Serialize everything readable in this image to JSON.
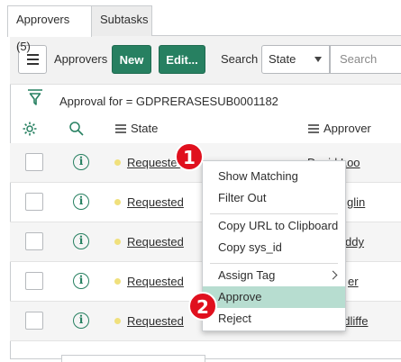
{
  "tabs": [
    {
      "label": "Approvers (5)",
      "active": true
    },
    {
      "label": "Subtasks",
      "active": false
    }
  ],
  "toolbar": {
    "title": "Approvers",
    "new_label": "New",
    "edit_label": "Edit...",
    "search_label": "Search",
    "search_field": "State",
    "search_placeholder": "Search"
  },
  "breadcrumb": {
    "text": "Approval for = GDPRERASESUB0001182"
  },
  "columns": {
    "state": "State",
    "approver": "Approver"
  },
  "rows": [
    {
      "state": "Requested",
      "approver": "David Loo"
    },
    {
      "state": "Requested",
      "approver": "glin"
    },
    {
      "state": "Requested",
      "approver": "ddy"
    },
    {
      "state": "Requested",
      "approver": "er"
    },
    {
      "state": "Requested",
      "approver": "odliffe"
    }
  ],
  "context_menu": {
    "items": [
      {
        "label": "Show Matching"
      },
      {
        "label": "Filter Out"
      },
      {
        "label": "Copy URL to Clipboard"
      },
      {
        "label": "Copy sys_id"
      },
      {
        "label": "Assign Tag"
      },
      {
        "label": "Approve",
        "highlighted": true
      },
      {
        "label": "Reject"
      }
    ]
  },
  "badges": [
    "1",
    "2"
  ],
  "colors": {
    "accent_green": "#278061",
    "badge_red": "#e0101e",
    "highlight": "#b7ddd0",
    "state_dot": "#f0e07c"
  }
}
